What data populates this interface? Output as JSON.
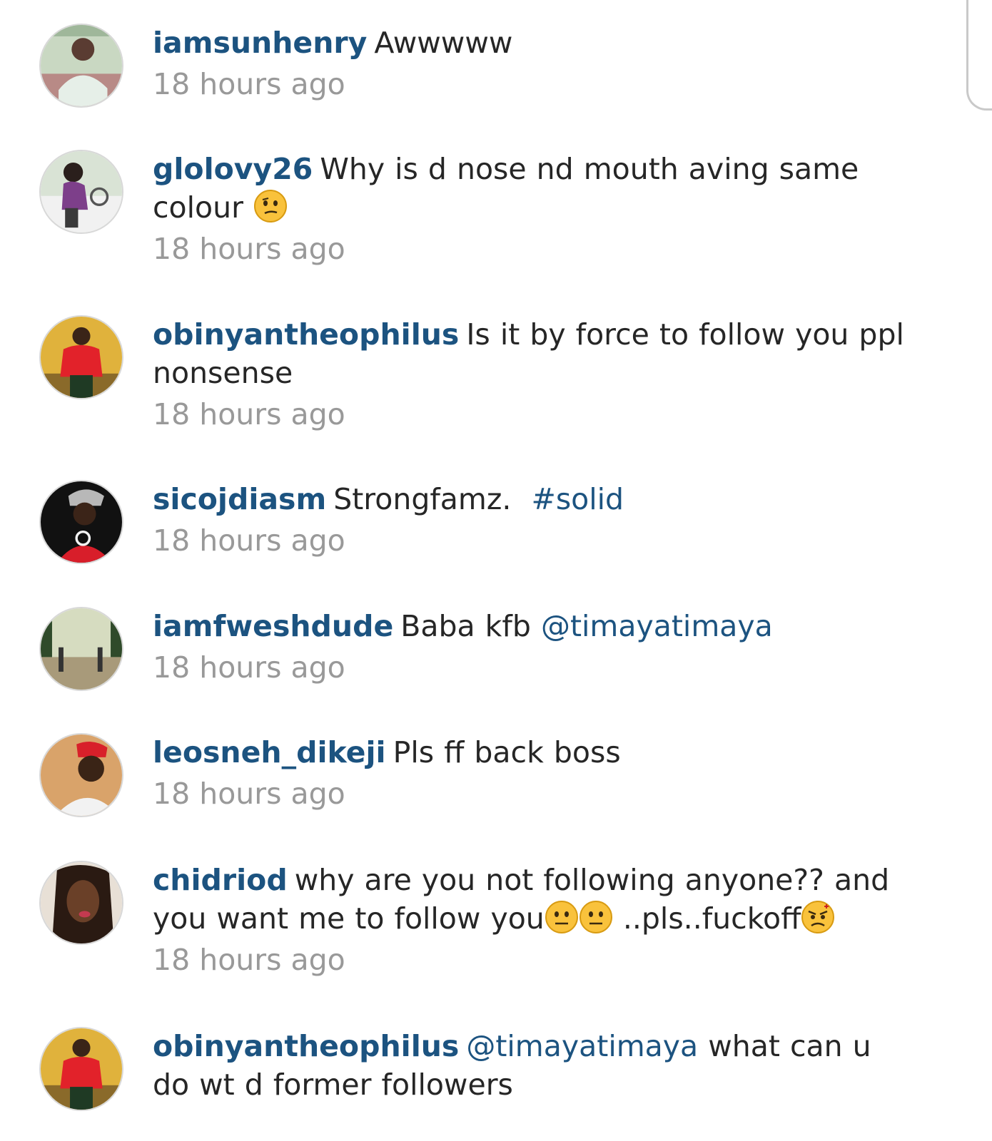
{
  "comments": [
    {
      "username": "iamsunhenry",
      "text": "Awwwww",
      "time": "18 hours ago",
      "avatar": "avatar-iamsunhenry"
    },
    {
      "username": "glolovy26",
      "text": "Why is d nose nd mouth aving same colour",
      "emoji": "confused-face-emoji",
      "time": "18 hours ago",
      "avatar": "avatar-glolovy26"
    },
    {
      "username": "obinyantheophilus",
      "text": "Is it by force to follow you ppl nonsense",
      "time": "18 hours ago",
      "avatar": "avatar-obinyantheophilus"
    },
    {
      "username": "sicojdiasm",
      "text": "Strongfamz.",
      "hashtag": "#solid",
      "time": "18 hours ago",
      "avatar": "avatar-sicojdiasm"
    },
    {
      "username": "iamfweshdude",
      "text": "Baba kfb",
      "mention": "@timayatimaya",
      "time": "18 hours ago",
      "avatar": "avatar-iamfweshdude"
    },
    {
      "username": "leosneh_dikeji",
      "text": "Pls ff back boss",
      "time": "18 hours ago",
      "avatar": "avatar-leosneh_dikeji"
    },
    {
      "username": "chidriod",
      "text_1": "why are you not following anyone?? and you want me to follow you",
      "text_2": "..pls..fuckoff",
      "emojis": [
        "neutral-face-emoji",
        "neutral-face-emoji",
        "angry-face-emoji"
      ],
      "time": "18 hours ago",
      "avatar": "avatar-chidriod"
    },
    {
      "username": "obinyantheophilus",
      "mention": "@timayatimaya",
      "text": "what can u do wt d former  followers",
      "avatar": "avatar-obinyantheophilus"
    }
  ],
  "colors": {
    "username": "#1c5380",
    "text": "#262626",
    "timestamp": "#999999",
    "background": "#ffffff"
  }
}
